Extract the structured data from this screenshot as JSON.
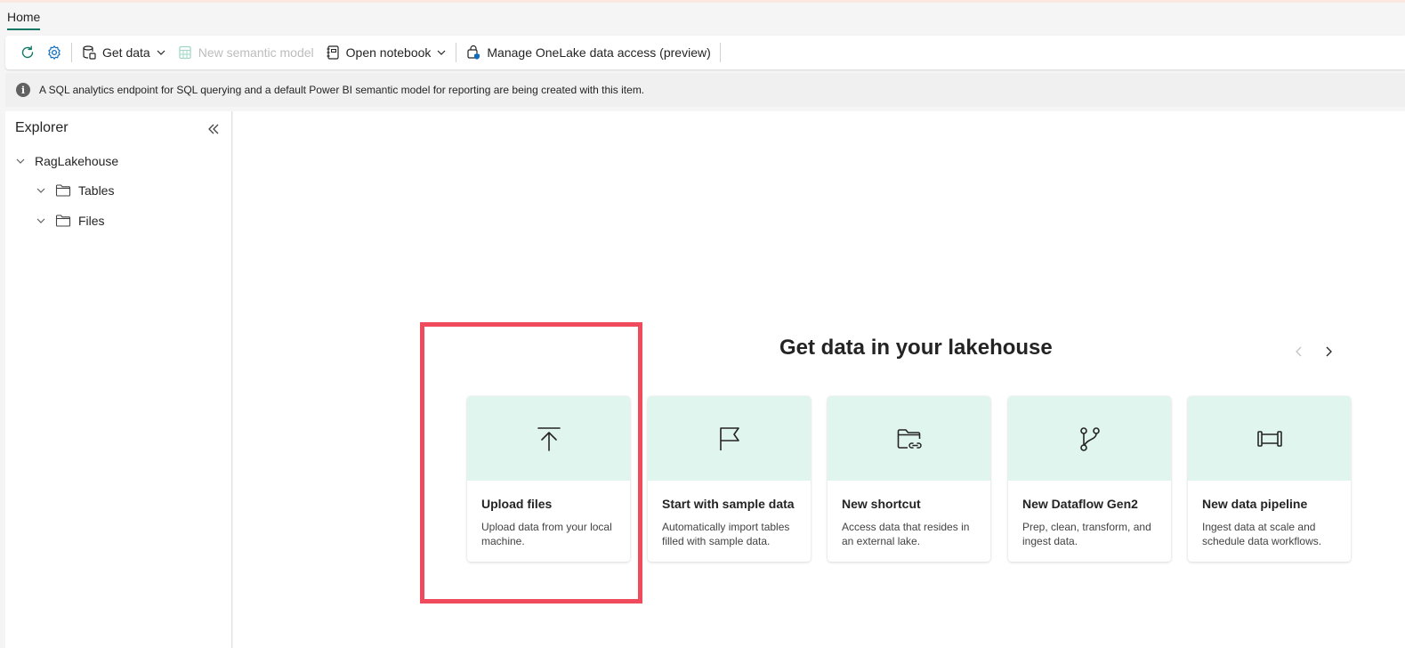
{
  "tabs": {
    "home": "Home"
  },
  "toolbar": {
    "get_data": "Get data",
    "new_semantic_model": "New semantic model",
    "open_notebook": "Open notebook",
    "manage_onelake": "Manage OneLake data access (preview)"
  },
  "info": {
    "message": "A SQL analytics endpoint for SQL querying and a default Power BI semantic model for reporting are being created with this item."
  },
  "explorer": {
    "title": "Explorer",
    "root": "RagLakehouse",
    "items": [
      {
        "label": "Tables"
      },
      {
        "label": "Files"
      }
    ]
  },
  "main": {
    "title": "Get data in your lakehouse",
    "cards": [
      {
        "title": "Upload files",
        "desc": "Upload data from your local machine.",
        "icon": "upload-icon"
      },
      {
        "title": "Start with sample data",
        "desc": "Automatically import tables filled with sample data.",
        "icon": "flag-icon"
      },
      {
        "title": "New shortcut",
        "desc": "Access data that resides in an external lake.",
        "icon": "folder-link-icon"
      },
      {
        "title": "New Dataflow Gen2",
        "desc": "Prep, clean, transform, and ingest data.",
        "icon": "branch-icon"
      },
      {
        "title": "New data pipeline",
        "desc": "Ingest data at scale and schedule data workflows.",
        "icon": "pipeline-icon"
      }
    ]
  },
  "colors": {
    "accent": "#117865",
    "card_header": "#e0f5ed",
    "highlight": "#ef4b5c"
  }
}
